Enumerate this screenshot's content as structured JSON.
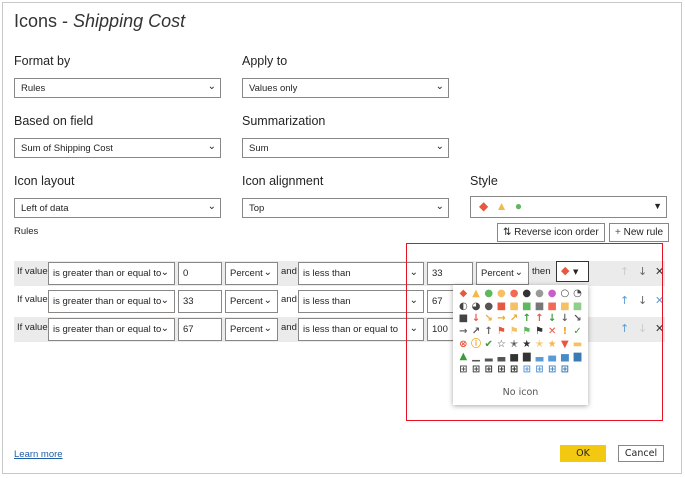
{
  "title": {
    "prefix": "Icons - ",
    "field": "Shipping Cost"
  },
  "format_by": {
    "label": "Format by",
    "value": "Rules"
  },
  "apply_to": {
    "label": "Apply to",
    "value": "Values only"
  },
  "based_on": {
    "label": "Based on field",
    "value": "Sum of Shipping Cost"
  },
  "summarization": {
    "label": "Summarization",
    "value": "Sum"
  },
  "icon_layout": {
    "label": "Icon layout",
    "value": "Left of data"
  },
  "icon_alignment": {
    "label": "Icon alignment",
    "value": "Top"
  },
  "style": {
    "label": "Style"
  },
  "rules_label": "Rules",
  "reverse_label": "Reverse icon order",
  "new_rule_label": "New rule",
  "rules": [
    {
      "if": "If value",
      "op1": "is greater than or equal to",
      "v1": "0",
      "t1": "Percent",
      "and": "and",
      "op2": "is less than",
      "v2": "33",
      "t2": "Percent",
      "then": "then"
    },
    {
      "if": "If value",
      "op1": "is greater than or equal to",
      "v1": "33",
      "t1": "Percent",
      "and": "and",
      "op2": "is less than",
      "v2": "67"
    },
    {
      "if": "If value",
      "op1": "is greater than or equal to",
      "v1": "67",
      "t1": "Percent",
      "and": "and",
      "op2": "is less than or equal to",
      "v2": "100"
    }
  ],
  "picker": {
    "no_icon": "No icon",
    "icons": [
      [
        "◆",
        "#e8573f"
      ],
      [
        "▲",
        "#f5b94a"
      ],
      [
        "●",
        "#5fb760"
      ],
      [
        "●",
        "#f5c163"
      ],
      [
        "●",
        "#f06a56"
      ],
      [
        "●",
        "#333"
      ],
      [
        "●",
        "#999"
      ],
      [
        "●",
        "#c95ec9"
      ],
      [
        "○",
        "#444"
      ],
      [
        "◔",
        "#444"
      ],
      [
        "◐",
        "#444"
      ],
      [
        "◕",
        "#444"
      ],
      [
        "●",
        "#555"
      ],
      [
        "■",
        "#e8573f"
      ],
      [
        "■",
        "#f5c163"
      ],
      [
        "■",
        "#5fb760"
      ],
      [
        "■",
        "#777"
      ],
      [
        "■",
        "#f06a56"
      ],
      [
        "■",
        "#f5c163"
      ],
      [
        "■",
        "#8fcf8a"
      ],
      [
        "■",
        "#444"
      ],
      [
        "↓",
        "#e8573f"
      ],
      [
        "↘",
        "#f5a623"
      ],
      [
        "→",
        "#f5a623"
      ],
      [
        "↗",
        "#f5a623"
      ],
      [
        "↑",
        "#3c9a3c"
      ],
      [
        "↑",
        "#e8573f"
      ],
      [
        "↓",
        "#3c9a3c"
      ],
      [
        "↓",
        "#666"
      ],
      [
        "↘",
        "#555"
      ],
      [
        "→",
        "#666"
      ],
      [
        "↗",
        "#555"
      ],
      [
        "↑",
        "#666"
      ],
      [
        "⚑",
        "#e8573f"
      ],
      [
        "⚑",
        "#f5c163"
      ],
      [
        "⚑",
        "#5fb760"
      ],
      [
        "⚑",
        "#333"
      ],
      [
        "✕",
        "#e8573f"
      ],
      [
        "!",
        "#f5a623"
      ],
      [
        "✓",
        "#3c9a3c"
      ],
      [
        "⊗",
        "#e8573f"
      ],
      [
        "ⓘ",
        "#f5a623"
      ],
      [
        "✔",
        "#3c9a3c"
      ],
      [
        "☆",
        "#444"
      ],
      [
        "✭",
        "#444"
      ],
      [
        "★",
        "#333"
      ],
      [
        "✭",
        "#f5b94a"
      ],
      [
        "★",
        "#f5b94a"
      ],
      [
        "▼",
        "#e8573f"
      ],
      [
        "▬",
        "#f5c163"
      ],
      [
        "▲",
        "#3c9a3c"
      ],
      [
        "▁",
        "#555"
      ],
      [
        "▂",
        "#555"
      ],
      [
        "▃",
        "#555"
      ],
      [
        "▅",
        "#333"
      ],
      [
        "▆",
        "#333"
      ],
      [
        "▃",
        "#5b9bd5"
      ],
      [
        "▄",
        "#5b9bd5"
      ],
      [
        "▅",
        "#4a8ac4"
      ],
      [
        "▆",
        "#3a7ab4"
      ],
      [
        "⊞",
        "#555"
      ],
      [
        "⊞",
        "#444"
      ],
      [
        "⊞",
        "#333"
      ],
      [
        "⊞",
        "#333"
      ],
      [
        "⊞",
        "#222"
      ],
      [
        "⊞",
        "#5b9bd5"
      ],
      [
        "⊞",
        "#5b9bd5"
      ],
      [
        "⊞",
        "#4a8ac4"
      ],
      [
        "⊞",
        "#3a7ab4"
      ]
    ]
  },
  "footer": {
    "learn_more": "Learn more",
    "ok": "OK",
    "cancel": "Cancel"
  },
  "colors": {
    "accent": "#f2c811",
    "highlight": "#e81123"
  }
}
